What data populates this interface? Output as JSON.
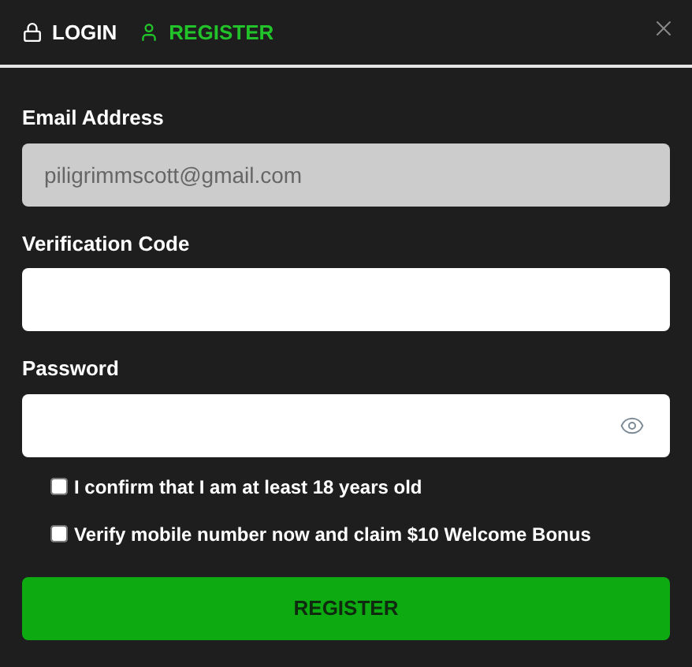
{
  "tabs": [
    {
      "label": "LOGIN",
      "kind": "lock",
      "selected": false
    },
    {
      "label": "REGISTER",
      "kind": "user",
      "selected": true
    }
  ],
  "fields": [
    {
      "label": "Email Address",
      "kind": "text",
      "value": "piligrimmscott@gmail.com",
      "disabled": true
    },
    {
      "label": "Verification Code",
      "kind": "text",
      "disabled": false
    },
    {
      "label": "Password",
      "kind": "password",
      "disabled": false
    }
  ],
  "checkboxes": [
    {
      "label": "I confirm that I am at least 18 years old",
      "checked": false
    },
    {
      "label": "Verify mobile number now and claim $10 Welcome Bonus",
      "checked": false
    }
  ],
  "submit": "REGISTER"
}
